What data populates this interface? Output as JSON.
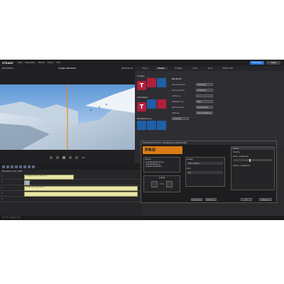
{
  "app": {
    "title": "Magix Video",
    "accent": "#2d6fd6"
  },
  "menubar": {
    "logo": "STRADE",
    "items": [
      "Datei",
      "Bearbeiten",
      "Effekte",
      "Extras",
      "Hilfe"
    ],
    "btn_export": "Exportieren",
    "btn_fertig": "Fertig"
  },
  "preview": {
    "left_time": "00:00:08:03",
    "title": "Projekt: Bahnfahrt*",
    "right_time": "00:00:31:24",
    "scrub_label": "Abs"
  },
  "right_tabs": [
    "Import",
    "Effekte",
    "Vorlagen",
    "Audio",
    "Store",
    "MAGIX Hub"
  ],
  "categories": [
    {
      "title": "Vorlagen",
      "tiles": [
        "T",
        "T",
        "T"
      ]
    },
    {
      "title": "Videoeffekte",
      "tiles": [
        "T",
        "T",
        "T"
      ]
    },
    {
      "title": "Bildstabilisierung",
      "tiles": [
        "T",
        "T",
        "T"
      ]
    }
  ],
  "props": {
    "header": "Mercalli Pro",
    "rows": [
      {
        "label": "Kamera Manu­fa",
        "value": "Analysieren"
      },
      {
        "label": "Kamera-Modell",
        "value": "Einstellung"
      },
      {
        "label": "Auflösung",
        "value": ""
      },
      {
        "label": "Stabilisierung",
        "value": "Pixel"
      },
      {
        "label": "Rolling Shutter",
        "value": "Kompensation"
      },
      {
        "label": "Glättung",
        "value": "Standardglättung"
      }
    ],
    "apply": "Anwenden"
  },
  "timeline": {
    "track_name": "MercalliPro_Video_1.MP4",
    "tracks": [
      {
        "head": "1",
        "clip": "Schlepplift_0001 - Vollbild_Ma"
      },
      {
        "head": "2",
        "clip": ""
      },
      {
        "head": "3",
        "clip": "Liftfahrt_002 - MVI_0001_2"
      },
      {
        "head": "4",
        "clip": ""
      },
      {
        "head": "5",
        "clip": ""
      }
    ]
  },
  "dialog": {
    "title": "proDAD Mercalli V4 SAL - Stabilisierung & Rolling Shutter",
    "logo": "PRO MERCALLI",
    "camera_label": "Kamera",
    "camera_opts": [
      "Auto-Modell-Erkennung",
      "Videostabilisierung",
      "Auswahl beibehalten"
    ],
    "analysis_label": "Analyse",
    "analysis_value": "Zoom, Kamera",
    "quality_label": "Qualität",
    "percent": "47%",
    "profile_label": "Profil",
    "profile_value": "Aus",
    "preview_label": "Vorschau",
    "tab_right": "Fenster",
    "opt1": "Zoom – Ausgleichen",
    "opt2": "Kamera – Ausgleichen",
    "btn_reset": "Zurücksetzen",
    "btn_cancel": "Abbrechen",
    "btn_ok": "OK"
  },
  "footer": {
    "status": "CPU: 6% | Speicher: OK"
  }
}
